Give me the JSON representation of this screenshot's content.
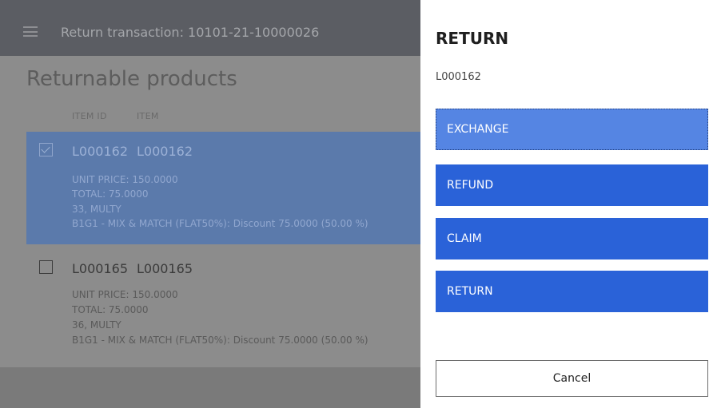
{
  "header": {
    "title": "Return transaction: 10101-21-10000026",
    "menu_icon": "hamburger-menu-icon"
  },
  "main": {
    "heading": "Returnable products",
    "columns": [
      "ITEM ID",
      "ITEM"
    ],
    "rows": [
      {
        "selected": true,
        "item_id": "L000162",
        "item": "L000162",
        "unit_price": "UNIT PRICE: 150.0000",
        "total": "TOTAL: 75.0000",
        "variant": "33, MULTY",
        "discount": "B1G1 - MIX & MATCH (FLAT50%): Discount 75.0000 (50.00 %)"
      },
      {
        "selected": false,
        "item_id": "L000165",
        "item": "L000165",
        "unit_price": "UNIT PRICE: 150.0000",
        "total": "TOTAL: 75.0000",
        "variant": "36, MULTY",
        "discount": "B1G1 - MIX & MATCH (FLAT50%): Discount 75.0000 (50.00 %)"
      }
    ]
  },
  "dialog": {
    "title": "RETURN",
    "subtitle": "L000162",
    "buttons": [
      "EXCHANGE",
      "REFUND",
      "CLAIM",
      "RETURN"
    ],
    "focused_button": "EXCHANGE",
    "cancel_label": "Cancel"
  },
  "colors": {
    "accent": "#2a62d8",
    "accent_focused": "#5585e3",
    "selected_row": "#5b7aab"
  }
}
